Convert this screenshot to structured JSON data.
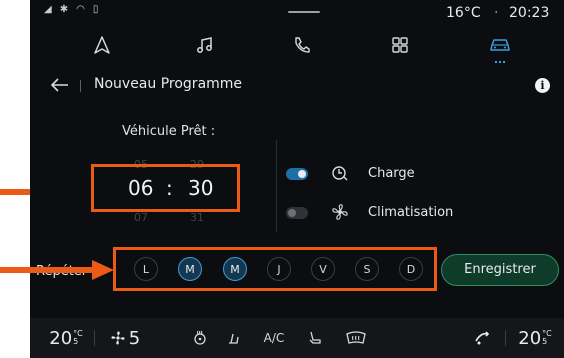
{
  "status_bar": {
    "temperature": "16°C",
    "separator": "·",
    "time": "20:23"
  },
  "nav": {
    "items": [
      {
        "name": "navigation",
        "icon": "navigation-arrow-icon"
      },
      {
        "name": "music",
        "icon": "music-note-icon"
      },
      {
        "name": "phone",
        "icon": "phone-icon"
      },
      {
        "name": "apps",
        "icon": "apps-grid-icon"
      },
      {
        "name": "vehicle",
        "icon": "car-icon",
        "active": true
      }
    ]
  },
  "header": {
    "title": "Nouveau Programme",
    "info_label": "i"
  },
  "schedule": {
    "ready_label": "Véhicule Prêt :",
    "hour": "06",
    "minute": "30",
    "time_separator": ":",
    "hour_prev": "05",
    "hour_next": "07",
    "minute_prev": "29",
    "minute_next": "31"
  },
  "options": [
    {
      "label": "Charge",
      "enabled": true,
      "icon": "charge-clock-icon"
    },
    {
      "label": "Climatisation",
      "enabled": false,
      "icon": "climate-fan-icon"
    }
  ],
  "repeat": {
    "label": "Répéter :",
    "days": [
      {
        "label": "L",
        "selected": false
      },
      {
        "label": "M",
        "selected": true
      },
      {
        "label": "M",
        "selected": true
      },
      {
        "label": "J",
        "selected": false
      },
      {
        "label": "V",
        "selected": false
      },
      {
        "label": "S",
        "selected": false
      },
      {
        "label": "D",
        "selected": false
      }
    ]
  },
  "save_button": "Enregistrer",
  "climate_bar": {
    "left_temp": "20",
    "left_unit": "°C",
    "left_fraction": "5",
    "fan_speed": "5",
    "ac_label": "A/C",
    "right_temp": "20",
    "right_unit": "°C",
    "right_fraction": "5"
  },
  "colors": {
    "highlight": "#ea5b18",
    "accent_blue": "#3aa0d8",
    "save_green": "#2f8f62"
  }
}
